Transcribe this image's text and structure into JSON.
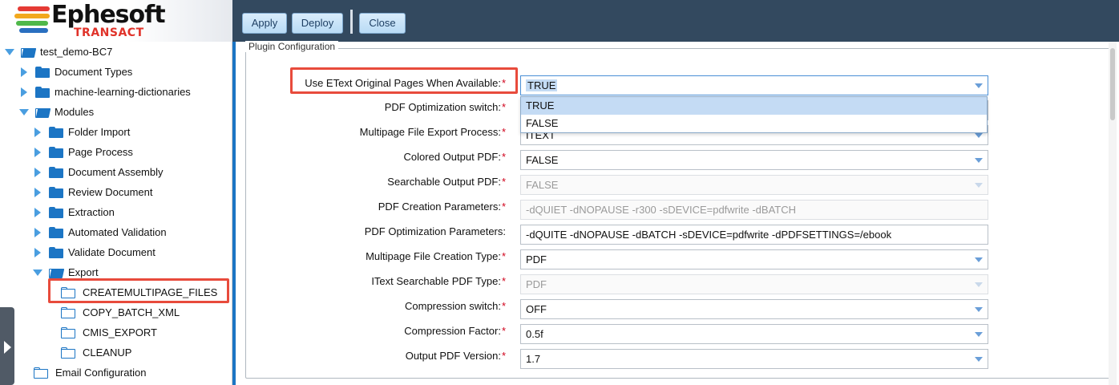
{
  "logo": {
    "name": "Ephesoft",
    "sub": "TRANSACT"
  },
  "toolbar": {
    "apply_label": "Apply",
    "deploy_label": "Deploy",
    "close_label": "Close"
  },
  "tree": {
    "root": "test_demo-BC7",
    "document_types": "Document Types",
    "ml_dictionaries": "machine-learning-dictionaries",
    "modules": "Modules",
    "folder_import": "Folder Import",
    "page_process": "Page Process",
    "document_assembly": "Document Assembly",
    "review_document": "Review Document",
    "extraction": "Extraction",
    "automated_validation": "Automated Validation",
    "validate_document": "Validate Document",
    "export": "Export",
    "createmultipage_files": "CREATEMULTIPAGE_FILES",
    "copy_batch_xml": "COPY_BATCH_XML",
    "cmis_export": "CMIS_EXPORT",
    "cleanup": "CLEANUP",
    "email_configuration": "Email Configuration"
  },
  "plugin": {
    "legend": "Plugin Configuration",
    "fields": [
      {
        "label": "Use EText Original Pages When Available:",
        "value": "TRUE"
      },
      {
        "label": "PDF Optimization switch:",
        "value": ""
      },
      {
        "label": "Multipage File Export Process:",
        "value": "ITEXT"
      },
      {
        "label": "Colored Output PDF:",
        "value": "FALSE"
      },
      {
        "label": "Searchable Output PDF:",
        "value": "FALSE"
      },
      {
        "label": "PDF Creation Parameters:",
        "value": "-dQUIET -dNOPAUSE -r300 -sDEVICE=pdfwrite -dBATCH"
      },
      {
        "label": "PDF Optimization Parameters:",
        "value": "-dQUITE -dNOPAUSE -dBATCH -sDEVICE=pdfwrite -dPDFSETTINGS=/ebook"
      },
      {
        "label": "Multipage File Creation Type:",
        "value": "PDF"
      },
      {
        "label": "IText Searchable PDF Type:",
        "value": "PDF"
      },
      {
        "label": "Compression switch:",
        "value": "OFF"
      },
      {
        "label": "Compression Factor:",
        "value": "0.5f"
      },
      {
        "label": "Output PDF Version:",
        "value": "1.7"
      }
    ],
    "required_marker": "*",
    "dropdown_options": [
      "TRUE",
      "FALSE"
    ]
  },
  "colors": {
    "toolbar_bg": "#33495f",
    "accent": "#1c75c4",
    "highlight": "#e84b3c"
  }
}
